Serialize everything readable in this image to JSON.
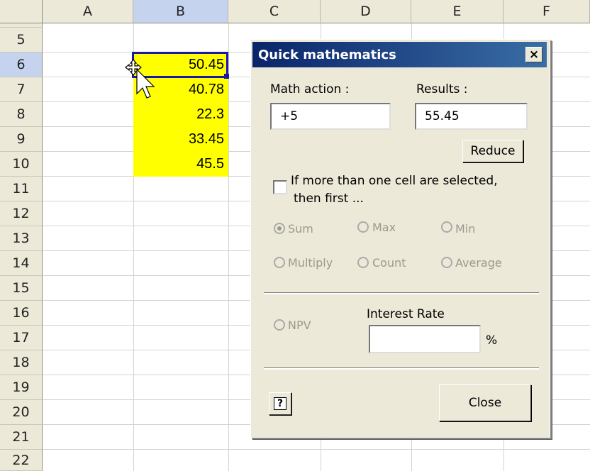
{
  "spreadsheet": {
    "columns": [
      "A",
      "B",
      "C",
      "D",
      "E",
      "F"
    ],
    "rows": [
      "5",
      "6",
      "7",
      "8",
      "9",
      "10",
      "11",
      "12",
      "13",
      "14",
      "15",
      "16",
      "17",
      "18",
      "19",
      "20",
      "21",
      "22"
    ],
    "cells_b": [
      "50.45",
      "40.78",
      "22.3",
      "33.45",
      "45.5"
    ],
    "highlight_color": "#ffff00",
    "selection_color": "#1a1aa0"
  },
  "dialog": {
    "title": "Quick mathematics",
    "close_x": "×",
    "math_action_label": "Math action :",
    "math_action_value": "+5",
    "results_label": "Results :",
    "results_value": "55.45",
    "reduce_label": "Reduce",
    "multi_cell_text_1": "If more than one cell are selected,",
    "multi_cell_text_2": "then first ...",
    "radio_sum": "Sum",
    "radio_max": "Max",
    "radio_min": "Min",
    "radio_multiply": "Multiply",
    "radio_count": "Count",
    "radio_average": "Average",
    "radio_npv": "NPV",
    "interest_rate_label": "Interest Rate",
    "interest_rate_value": "",
    "percent_sign": "%",
    "help_label": "?",
    "close_label": "Close"
  }
}
